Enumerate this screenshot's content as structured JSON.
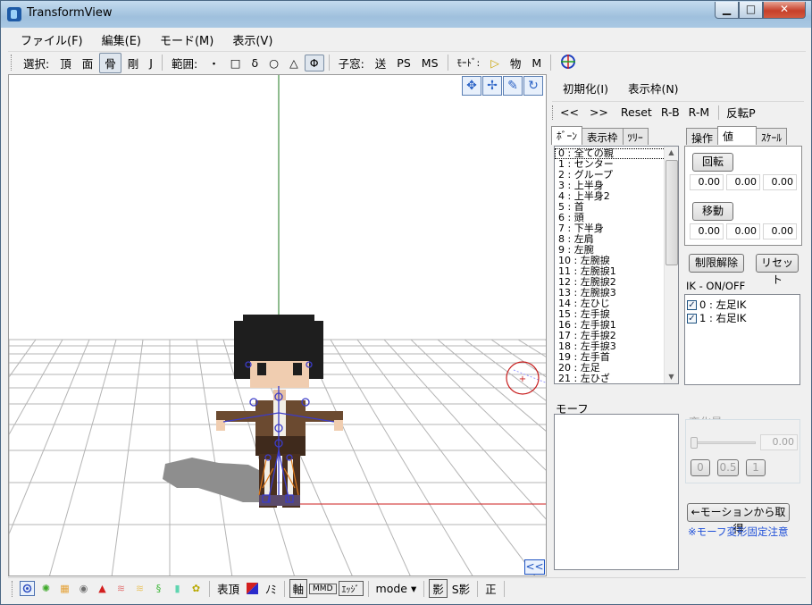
{
  "window": {
    "title": "TransformView"
  },
  "menu": [
    "ファイル(F)",
    "編集(E)",
    "モード(M)",
    "表示(V)"
  ],
  "toolbar": {
    "select_label": "選択:",
    "select_items": [
      "頂",
      "面",
      "骨",
      "剛",
      "J"
    ],
    "range_label": "範囲:",
    "range_items": [
      "・",
      "□",
      "δ",
      "○",
      "△",
      "Φ"
    ],
    "child_label": "子窓:",
    "child_items": [
      "送",
      "PS",
      "MS"
    ],
    "mode_label": "ﾓｰﾄﾞ:",
    "mode_items": [
      "▷",
      "物",
      "M"
    ]
  },
  "panel": {
    "init_label": "初期化(I)",
    "frame_label": "表示枠(N)",
    "nav": [
      "<<",
      ">>",
      "Reset",
      "R-B",
      "R-M",
      "反転P"
    ],
    "bone_tabs": [
      "ﾎﾞｰﾝ",
      "表示枠",
      "ﾂﾘｰ"
    ],
    "bones": [
      "0 : 全ての親",
      "1 : センター",
      "2 : グループ",
      "3 : 上半身",
      "4 : 上半身2",
      "5 : 首",
      "6 : 頭",
      "7 : 下半身",
      "8 : 左肩",
      "9 : 左腕",
      "10 : 左腕捩",
      "11 : 左腕捩1",
      "12 : 左腕捩2",
      "13 : 左腕捩3",
      "14 : 左ひじ",
      "15 : 左手捩",
      "16 : 左手捩1",
      "17 : 左手捩2",
      "18 : 左手捩3",
      "19 : 左手首",
      "20 : 左足",
      "21 : 左ひざ"
    ],
    "value_tabs": [
      "操作",
      "値",
      "ｽｹｰﾙ"
    ],
    "rotate_label": "回転",
    "rotate_values": [
      "0.00",
      "0.00",
      "0.00"
    ],
    "move_label": "移動",
    "move_values": [
      "0.00",
      "0.00",
      "0.00"
    ],
    "unlock_label": "制限解除",
    "reset_label": "リセット",
    "ik_title": "IK - ON/OFF",
    "ik_items": [
      "0 : 左足IK",
      "1 : 右足IK"
    ],
    "morph_title": "モーフ",
    "change_title": "変化量",
    "change_value": "0.00",
    "preset_buttons": [
      "0",
      "0.5",
      "1"
    ],
    "fetch_label": "←モーションから取得",
    "note": "※モーフ変形固定注意"
  },
  "statusbar": {
    "surface_label": "表頂",
    "no_label": "ﾉﾐ",
    "axis_label": "軸",
    "mmd_label": "MMD",
    "edge_label": "ｴｯｼﾞ",
    "mode_label": "mode ▾",
    "shadow_label": "影",
    "sshadow_label": "S影",
    "seikei_label": "正"
  },
  "colors": {
    "accent": "#1e53c1",
    "note": "#1e4fd8",
    "grid": "#b4b4b4",
    "axis_x": "#cc1c1c",
    "axis_y": "#1f7a1f"
  }
}
